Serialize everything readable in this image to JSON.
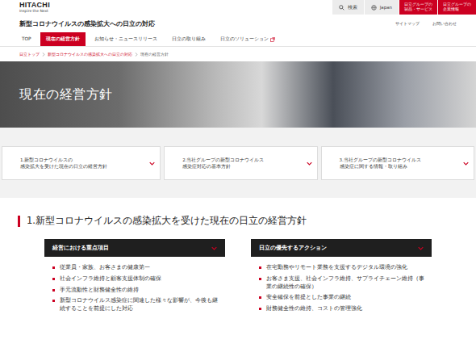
{
  "header": {
    "logo": "HITACHI",
    "tagline": "Inspire the Next",
    "buttons": [
      {
        "label": "検索",
        "icon": "search"
      },
      {
        "label": "Japan",
        "icon": "globe"
      }
    ],
    "group_links": [
      {
        "lines": [
          "日立グループの",
          "製品・サービス"
        ]
      },
      {
        "lines": [
          "日立グループの",
          "企業情報"
        ]
      }
    ]
  },
  "site": {
    "title": "新型コロナウイルスの感染拡大への日立の対応",
    "links": [
      "サイトマップ",
      "お問い合わせ"
    ]
  },
  "tabs": [
    {
      "label": "TOP",
      "selected": false,
      "external": false
    },
    {
      "label": "現在の経営方針",
      "selected": true,
      "external": false
    },
    {
      "label": "お知らせ・ニュースリリース",
      "selected": false,
      "external": false
    },
    {
      "label": "日立の取り組み",
      "selected": false,
      "external": false
    },
    {
      "label": "日立のソリューション",
      "selected": false,
      "external": true
    }
  ],
  "breadcrumb": [
    {
      "label": "日立トップ",
      "current": false
    },
    {
      "label": "新型コロナウイルスの感染拡大への日立の対応",
      "current": false
    },
    {
      "label": "現在の経営方針",
      "current": true
    }
  ],
  "hero": {
    "title": "現在の経営方針"
  },
  "anchors": [
    {
      "lines": [
        "1.新型コロナウイルスの",
        "感染拡大を受けた現在の日立の経営方針"
      ]
    },
    {
      "lines": [
        "2.当社グループの新型コロナウイルス",
        "感染症対応の基本方針"
      ]
    },
    {
      "lines": [
        "3.当社グループの新型コロナウイルス",
        "感染症に関する情報・取り組み"
      ]
    }
  ],
  "section": {
    "title": "1.新型コロナウイルスの感染拡大を受けた現在の日立の経営方針"
  },
  "panels": [
    {
      "title": "経営における重点項目",
      "items": [
        "従業員・家族、お客さまの健康第一",
        "社会インフラ維持と顧客支援体制の確保",
        "手元流動性と財務健全性の維持",
        "新型コロナウイルス感染症に関連した様々な影響が、今後も継続することを前提にした対応"
      ]
    },
    {
      "title": "日立の優先するアクション",
      "items": [
        "在宅勤務やリモート業務を支援するデジタル環境の強化",
        "お客さま支援、社会インフラ維持、サプライチェーン維持（事業の継続性の確保）",
        "安全確保を前提とした事業の継続",
        "財務健全性の維持、コストの管理強化"
      ]
    }
  ]
}
